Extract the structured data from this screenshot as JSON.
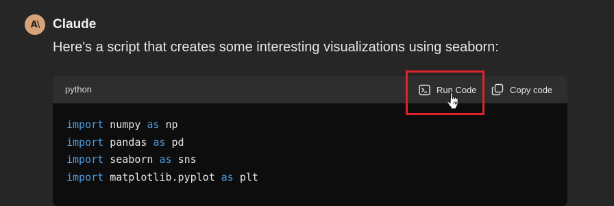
{
  "message": {
    "sender": "Claude",
    "avatar_text": "A\\",
    "intro": "Here's a script that creates some interesting visualizations using seaborn:"
  },
  "codeblock": {
    "language": "python",
    "run_button": "Run Code",
    "copy_button": "Copy code",
    "lines": [
      {
        "kw1": "import",
        "mod": "numpy",
        "kw2": "as",
        "alias": "np"
      },
      {
        "kw1": "import",
        "mod": "pandas",
        "kw2": "as",
        "alias": "pd"
      },
      {
        "kw1": "import",
        "mod": "seaborn",
        "kw2": "as",
        "alias": "sns"
      },
      {
        "kw1": "import",
        "mod": "matplotlib.pyplot",
        "kw2": "as",
        "alias": "plt"
      }
    ]
  },
  "colors": {
    "background": "#262626",
    "code_background": "#0d0d0d",
    "code_header": "#2e2e2e",
    "keyword": "#4f9ae0",
    "highlight_box": "#e0222a",
    "avatar": "#d9a37a"
  },
  "icons": {
    "run": "terminal-icon",
    "copy": "copy-icon",
    "cursor": "hand-pointer-icon"
  }
}
